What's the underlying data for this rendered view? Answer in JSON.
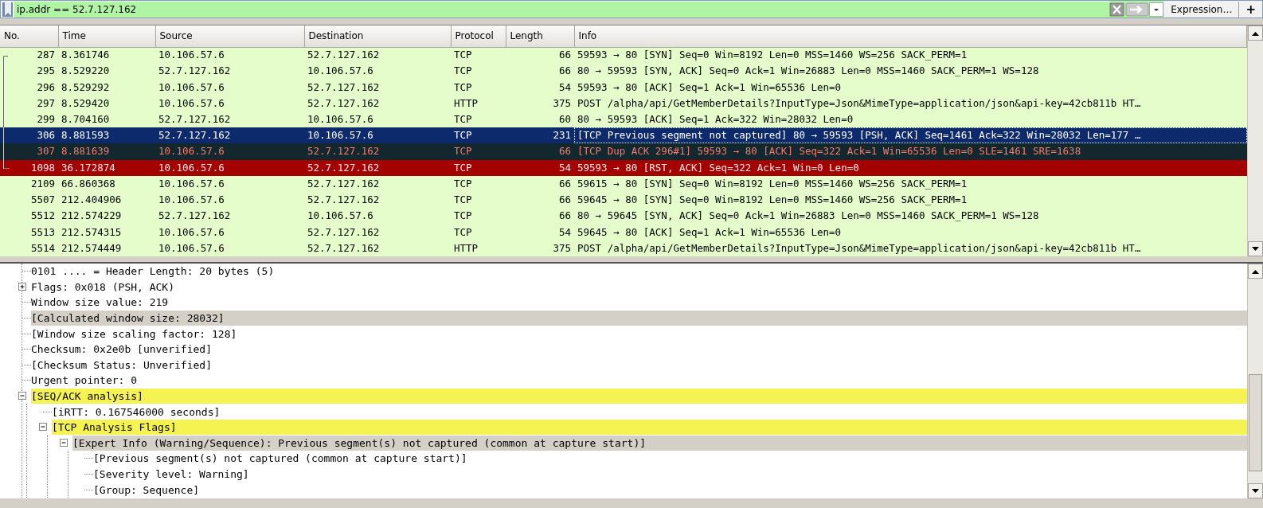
{
  "filter": {
    "value": "ip.addr == 52.7.127.162",
    "expression_button": "Expression…",
    "add_button": "+"
  },
  "packet_list": {
    "columns": [
      "No.",
      "Time",
      "Source",
      "Destination",
      "Protocol",
      "Length",
      "Info"
    ],
    "rows": [
      {
        "no": "287",
        "time": "8.361746",
        "source": "10.106.57.6",
        "destination": "52.7.127.162",
        "protocol": "TCP",
        "length": "66",
        "info": "59593 → 80 [SYN] Seq=0 Win=8192 Len=0 MSS=1460 WS=256 SACK_PERM=1",
        "kind": "normal",
        "selected": false,
        "related": true
      },
      {
        "no": "295",
        "time": "8.529220",
        "source": "52.7.127.162",
        "destination": "10.106.57.6",
        "protocol": "TCP",
        "length": "66",
        "info": "80 → 59593 [SYN, ACK] Seq=0 Ack=1 Win=26883 Len=0 MSS=1460 SACK_PERM=1 WS=128",
        "kind": "normal",
        "selected": false,
        "related": true
      },
      {
        "no": "296",
        "time": "8.529292",
        "source": "10.106.57.6",
        "destination": "52.7.127.162",
        "protocol": "TCP",
        "length": "54",
        "info": "59593 → 80 [ACK] Seq=1 Ack=1 Win=65536 Len=0",
        "kind": "normal",
        "selected": false,
        "related": true
      },
      {
        "no": "297",
        "time": "8.529420",
        "source": "10.106.57.6",
        "destination": "52.7.127.162",
        "protocol": "HTTP",
        "length": "375",
        "info": "POST /alpha/api/GetMemberDetails?InputType=Json&MimeType=application/json&api-key=42cb811b HT…",
        "kind": "normal",
        "selected": false,
        "related": true
      },
      {
        "no": "299",
        "time": "8.704160",
        "source": "52.7.127.162",
        "destination": "10.106.57.6",
        "protocol": "TCP",
        "length": "60",
        "info": "80 → 59593 [ACK] Seq=1 Ack=322 Win=28032 Len=0",
        "kind": "normal",
        "selected": false,
        "related": true
      },
      {
        "no": "306",
        "time": "8.881593",
        "source": "52.7.127.162",
        "destination": "10.106.57.6",
        "protocol": "TCP",
        "length": "231",
        "info": "[TCP Previous segment not captured] 80 → 59593 [PSH, ACK] Seq=1461 Ack=322 Win=28032 Len=177 …",
        "selected": true,
        "related": true
      },
      {
        "no": "307",
        "time": "8.881639",
        "source": "10.106.57.6",
        "destination": "52.7.127.162",
        "protocol": "TCP",
        "length": "66",
        "info": "[TCP Dup ACK 296#1] 59593 → 80 [ACK] Seq=322 Ack=1 Win=65536 Len=0 SLE=1461 SRE=1638",
        "kind": "dup_ack",
        "selected": false,
        "related": true
      },
      {
        "no": "1098",
        "time": "36.172874",
        "source": "10.106.57.6",
        "destination": "52.7.127.162",
        "protocol": "TCP",
        "length": "54",
        "info": "59593 → 80 [RST, ACK] Seq=322 Ack=1 Win=0 Len=0",
        "kind": "reset",
        "selected": false,
        "related": true
      },
      {
        "no": "2109",
        "time": "66.860368",
        "source": "10.106.57.6",
        "destination": "52.7.127.162",
        "protocol": "TCP",
        "length": "66",
        "info": "59615 → 80 [SYN] Seq=0 Win=8192 Len=0 MSS=1460 WS=256 SACK_PERM=1",
        "kind": "normal",
        "selected": false,
        "related": false
      },
      {
        "no": "5507",
        "time": "212.404906",
        "source": "10.106.57.6",
        "destination": "52.7.127.162",
        "protocol": "TCP",
        "length": "66",
        "info": "59645 → 80 [SYN] Seq=0 Win=8192 Len=0 MSS=1460 WS=256 SACK_PERM=1",
        "kind": "normal",
        "selected": false,
        "related": false
      },
      {
        "no": "5512",
        "time": "212.574229",
        "source": "52.7.127.162",
        "destination": "10.106.57.6",
        "protocol": "TCP",
        "length": "66",
        "info": "80 → 59645 [SYN, ACK] Seq=0 Ack=1 Win=26883 Len=0 MSS=1460 SACK_PERM=1 WS=128",
        "kind": "normal",
        "selected": false,
        "related": false
      },
      {
        "no": "5513",
        "time": "212.574315",
        "source": "10.106.57.6",
        "destination": "52.7.127.162",
        "protocol": "TCP",
        "length": "54",
        "info": "59645 → 80 [ACK] Seq=1 Ack=1 Win=65536 Len=0",
        "kind": "normal",
        "selected": false,
        "related": false
      },
      {
        "no": "5514",
        "time": "212.574449",
        "source": "10.106.57.6",
        "destination": "52.7.127.162",
        "protocol": "HTTP",
        "length": "375",
        "info": "POST /alpha/api/GetMemberDetails?InputType=Json&MimeType=application/json&api-key=42cb811b HT…",
        "kind": "normal",
        "selected": false,
        "related": false
      }
    ]
  },
  "details": {
    "items": [
      {
        "text": "0101 .... = Header Length: 20 bytes (5)"
      },
      {
        "text": "Flags: 0x018 (PSH, ACK)",
        "expanded": false
      },
      {
        "text": "Window size value: 219"
      },
      {
        "text": "[Calculated window size: 28032]",
        "color": "#d4d0c8"
      },
      {
        "text": "[Window size scaling factor: 128]"
      },
      {
        "text": "Checksum: 0x2e0b [unverified]"
      },
      {
        "text": "[Checksum Status: Unverified]"
      },
      {
        "text": "Urgent pointer: 0"
      },
      {
        "text": "[SEQ/ACK analysis]",
        "expanded": true,
        "color": "#f5f352",
        "children": [
          {
            "text": "[iRTT: 0.167546000 seconds]"
          },
          {
            "text": "[TCP Analysis Flags]",
            "expanded": true,
            "color": "#f5f352",
            "children": [
              {
                "text": "[Expert Info (Warning/Sequence): Previous segment(s) not captured (common at capture start)]",
                "expanded": true,
                "color": "#d4d0c8",
                "children": [
                  {
                    "text": "[Previous segment(s) not captured (common at capture start)]"
                  },
                  {
                    "text": "[Severity level: Warning]"
                  },
                  {
                    "text": "[Group: Sequence]"
                  }
                ]
              }
            ]
          }
        ]
      }
    ]
  }
}
